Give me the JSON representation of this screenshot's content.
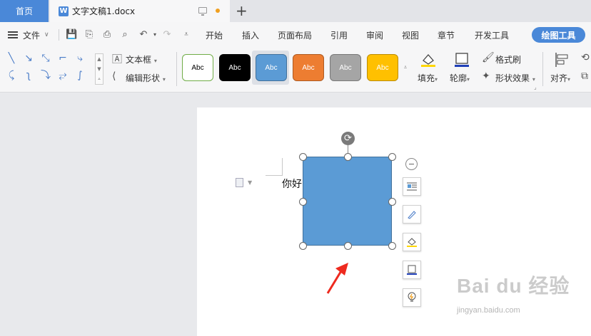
{
  "tabs": {
    "home_label": "首页",
    "doc_icon": "W",
    "doc_title": "文字文稿1.docx"
  },
  "menu": {
    "file_label": "文件",
    "items": [
      "开始",
      "插入",
      "页面布局",
      "引用",
      "审阅",
      "视图",
      "章节",
      "开发工具"
    ],
    "active_tool_label": "绘图工具"
  },
  "ribbon": {
    "textbox_label": "文本框",
    "edit_shape_label": "编辑形状",
    "styles": [
      {
        "label": "Abc",
        "bg": "#ffffff",
        "border": "#70ad47",
        "color": "#000000"
      },
      {
        "label": "Abc",
        "bg": "#000000",
        "border": "#000000",
        "color": "#ffffff"
      },
      {
        "label": "Abc",
        "bg": "#5b9bd5",
        "border": "#41719c",
        "color": "#ffffff"
      },
      {
        "label": "Abc",
        "bg": "#ed7d31",
        "border": "#ae5a21",
        "color": "#ffffff"
      },
      {
        "label": "Abc",
        "bg": "#a5a5a5",
        "border": "#787878",
        "color": "#ffffff"
      },
      {
        "label": "Abc",
        "bg": "#ffc000",
        "border": "#bc8c00",
        "color": "#ffffff"
      }
    ],
    "fill_label": "填充",
    "outline_label": "轮廓",
    "format_painter_label": "格式刷",
    "shape_effects_label": "形状效果",
    "align_label": "对齐"
  },
  "document": {
    "body_text": "你好",
    "shape_color": "#5b9bd5"
  },
  "watermark": {
    "brand": "Bai du 经验",
    "url": "jingyan.baidu.com"
  }
}
